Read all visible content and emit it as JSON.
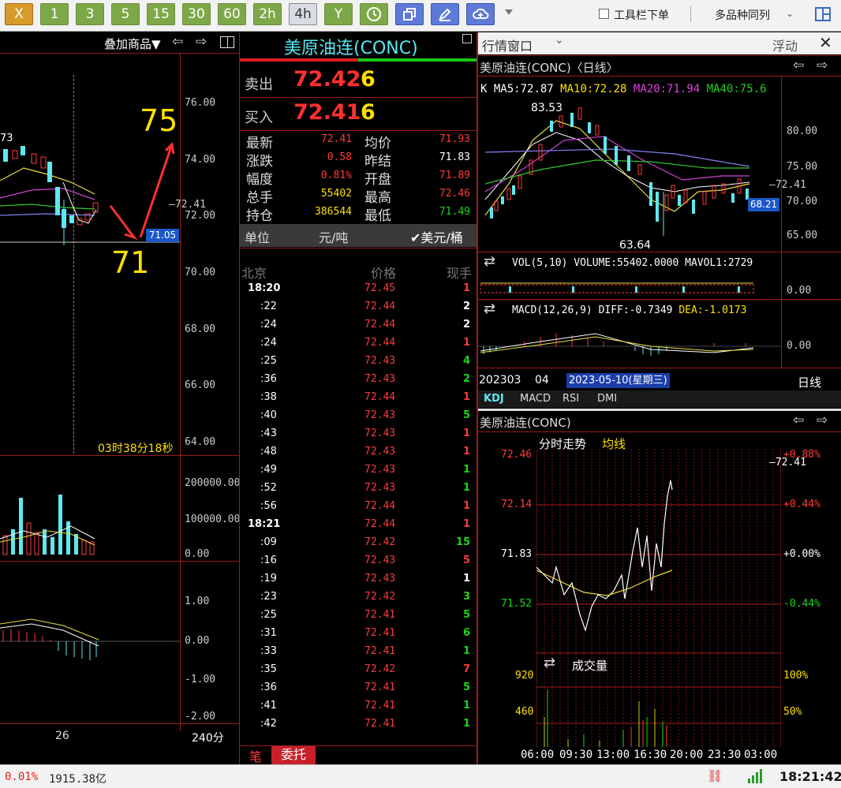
{
  "toolbar": {
    "buttons": [
      "X",
      "1",
      "3",
      "5",
      "15",
      "30",
      "60",
      "2h",
      "4h",
      "Y"
    ],
    "tools_label": "工具栏下单",
    "multi_label": "多品种同列"
  },
  "left": {
    "overlay_label": "叠加商品▼",
    "price_axis": [
      "76.00",
      "74.00",
      "72.41",
      "72.00",
      "70.00",
      "68.00",
      "66.00",
      "64.00"
    ],
    "marker_current": "71.05",
    "annot_75": "75",
    "annot_71": "71",
    "partial_label": "73",
    "timer": "03时38分18秒",
    "vol_axis": [
      "200000.00",
      "100000.00",
      "0.00"
    ],
    "macd_axis": [
      "1.00",
      "0.00",
      "-1.00",
      "-2.00"
    ],
    "bottom_date": "26",
    "bottom_period": "240分"
  },
  "quote": {
    "title": "美原油连(CONC)",
    "sell_label": "卖出",
    "sell_price": "72.42",
    "sell_vol": "6",
    "buy_label": "买入",
    "buy_price": "72.41",
    "buy_vol": "6",
    "stats": [
      {
        "l1": "最新",
        "v1": "72.41",
        "c1": "red",
        "l2": "均价",
        "v2": "71.93",
        "c2": "red"
      },
      {
        "l1": "涨跌",
        "v1": "0.58",
        "c1": "red",
        "l2": "昨结",
        "v2": "71.83",
        "c2": "white"
      },
      {
        "l1": "幅度",
        "v1": "0.81%",
        "c1": "red",
        "l2": "开盘",
        "v2": "71.89",
        "c2": "red"
      },
      {
        "l1": "总手",
        "v1": "55402",
        "c1": "yellow",
        "l2": "最高",
        "v2": "72.46",
        "c2": "red"
      },
      {
        "l1": "持仓",
        "v1": "386544",
        "c1": "yellow",
        "l2": "最低",
        "v2": "71.49",
        "c2": "green"
      }
    ],
    "unit_label": "单位",
    "unit_a": "元/吨",
    "unit_b": "✔美元/桶",
    "tick_head": [
      "北京",
      "价格",
      "现手"
    ],
    "ticks": [
      {
        "t": "18:20",
        "p": "72.45",
        "v": "1",
        "vc": "red",
        "bold": true
      },
      {
        "t": ":22",
        "p": "72.44",
        "v": "2",
        "vc": "white"
      },
      {
        "t": ":24",
        "p": "72.44",
        "v": "2",
        "vc": "white"
      },
      {
        "t": ":24",
        "p": "72.44",
        "v": "1",
        "vc": "red"
      },
      {
        "t": ":25",
        "p": "72.43",
        "v": "4",
        "vc": "green"
      },
      {
        "t": ":36",
        "p": "72.43",
        "v": "2",
        "vc": "green"
      },
      {
        "t": ":38",
        "p": "72.44",
        "v": "1",
        "vc": "red"
      },
      {
        "t": ":40",
        "p": "72.43",
        "v": "5",
        "vc": "green"
      },
      {
        "t": ":43",
        "p": "72.43",
        "v": "1",
        "vc": "red"
      },
      {
        "t": ":48",
        "p": "72.43",
        "v": "1",
        "vc": "red"
      },
      {
        "t": ":49",
        "p": "72.43",
        "v": "1",
        "vc": "green"
      },
      {
        "t": ":52",
        "p": "72.43",
        "v": "1",
        "vc": "green"
      },
      {
        "t": ":56",
        "p": "72.44",
        "v": "1",
        "vc": "red"
      },
      {
        "t": "18:21",
        "p": "72.44",
        "v": "1",
        "vc": "red",
        "bold": true
      },
      {
        "t": ":09",
        "p": "72.42",
        "v": "15",
        "vc": "green"
      },
      {
        "t": ":16",
        "p": "72.43",
        "v": "5",
        "vc": "red"
      },
      {
        "t": ":19",
        "p": "72.43",
        "v": "1",
        "vc": "white"
      },
      {
        "t": ":23",
        "p": "72.42",
        "v": "3",
        "vc": "green"
      },
      {
        "t": ":25",
        "p": "72.41",
        "v": "5",
        "vc": "green"
      },
      {
        "t": ":31",
        "p": "72.41",
        "v": "6",
        "vc": "green"
      },
      {
        "t": ":33",
        "p": "72.41",
        "v": "1",
        "vc": "green"
      },
      {
        "t": ":35",
        "p": "72.42",
        "v": "7",
        "vc": "red"
      },
      {
        "t": ":36",
        "p": "72.41",
        "v": "5",
        "vc": "green"
      },
      {
        "t": ":41",
        "p": "72.41",
        "v": "1",
        "vc": "green"
      },
      {
        "t": ":42",
        "p": "72.41",
        "v": "1",
        "vc": "green"
      }
    ],
    "tab_bi": "笔",
    "tab_wt": "委托"
  },
  "market": {
    "window_title": "行情窗口",
    "float_label": "浮动",
    "day_title": "美原油连(CONC)〈日线〉",
    "ma": {
      "k": "K",
      "ma5": "MA5:72.87",
      "ma10": "MA10:72.28",
      "ma20": "MA20:71.94",
      "ma40": "MA40:75.6"
    },
    "hi": "83.53",
    "lo": "63.64",
    "axis": [
      "80.00",
      "75.00",
      "72.41",
      "70.00",
      "65.00"
    ],
    "marker": "68.21",
    "vol_line": "VOL(5,10) VOLUME:55402.0000 MAVOL1:2729",
    "vol_zero": "0.00",
    "macd_line": "MACD(12,26,9) DIFF:-0.7349",
    "macd_dea": "DEA:-1.0173",
    "macd_zero": "0.00",
    "date_a": "202303",
    "date_b": "04",
    "date_sel": "2023-05-10(星期三)",
    "period": "日线",
    "tabs": [
      "KDJ",
      "MACD",
      "RSI",
      "DMI"
    ],
    "intra_title": "美原油连(CONC)",
    "intra_label": "分时走势",
    "intra_avg": "均线",
    "intra_left": [
      "72.46",
      "72.14",
      "71.83",
      "71.52"
    ],
    "intra_right": [
      "+0.88%",
      "+0.44%",
      "+0.00%",
      "-0.44%"
    ],
    "intra_last": "72.41",
    "vol_title": "成交量",
    "vol_left": [
      "920",
      "460"
    ],
    "vol_right": [
      "100%",
      "50%"
    ],
    "times": [
      "06:00",
      "09:30",
      "13:00",
      "16:30",
      "20:00",
      "23:30",
      "03:00"
    ]
  },
  "status": {
    "pct": "0.01%",
    "amount": "1915.38亿",
    "clock": "18:21:42"
  }
}
